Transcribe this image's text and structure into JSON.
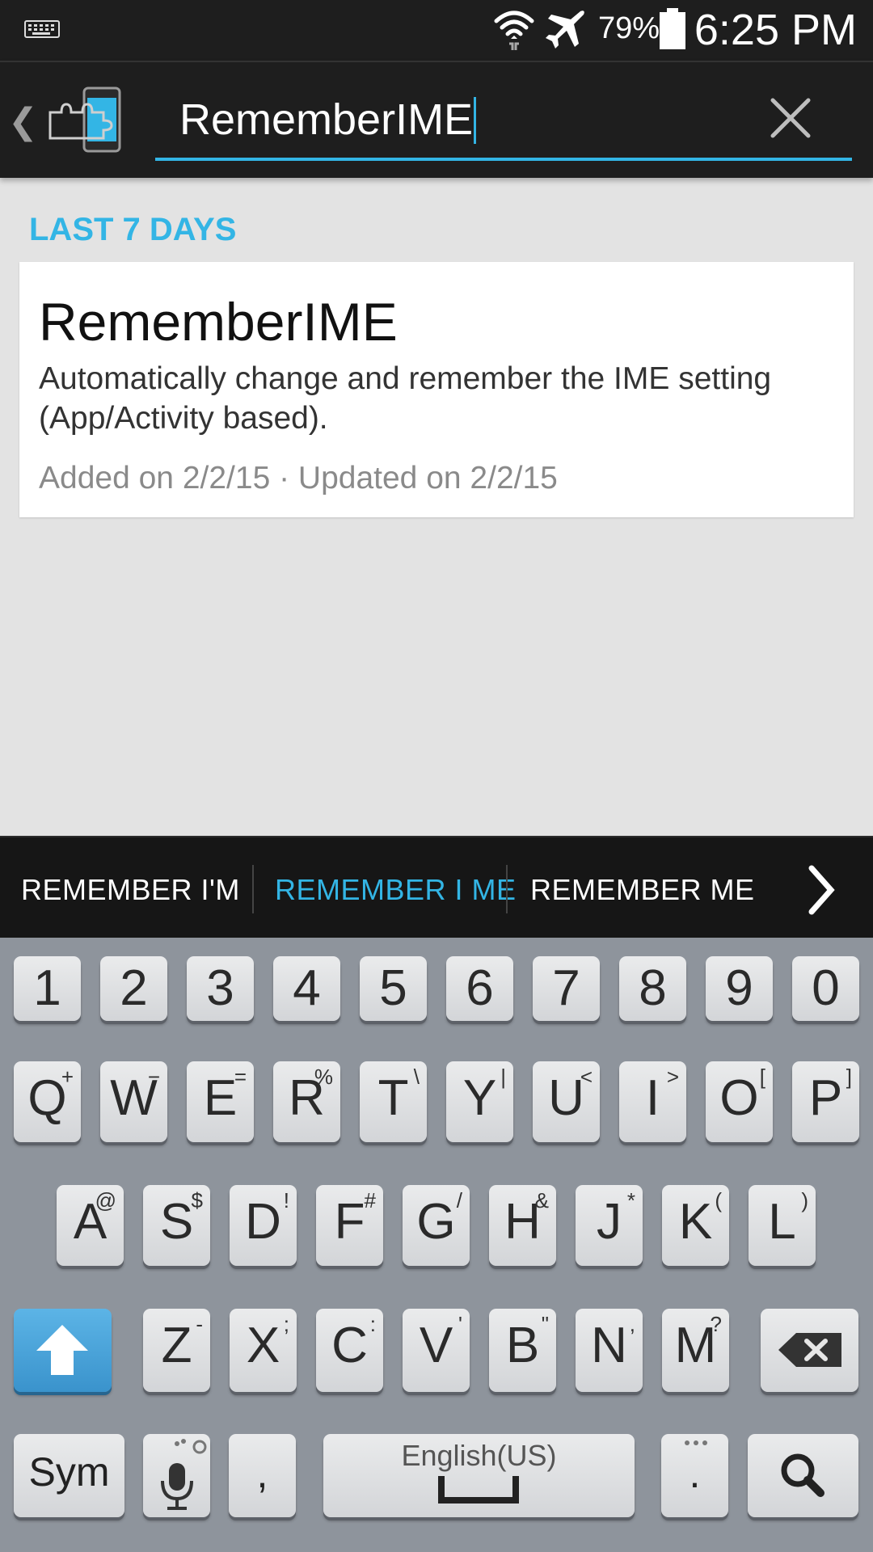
{
  "status_bar": {
    "battery_percent": "79%",
    "time": "6:25 PM",
    "icons": [
      "keyboard-icon",
      "wifi-icon",
      "airplane-mode-icon",
      "battery-icon"
    ]
  },
  "search": {
    "value": "RememberIME",
    "icons": [
      "back-icon",
      "xposed-installer-app-icon",
      "clear-icon"
    ]
  },
  "results": {
    "section_header": "LAST 7 DAYS",
    "items": [
      {
        "title": "RememberIME",
        "description": "Automatically change and remember the IME setting (App/Activity based).",
        "meta": "Added on 2/2/15 · Updated on 2/2/15"
      }
    ]
  },
  "suggestions": {
    "items": [
      "REMEMBER I'M",
      "REMEMBER I ME",
      "REMEMBER ME"
    ],
    "active_index": 1,
    "accent_color": "#33b5e5"
  },
  "keyboard": {
    "number_row": [
      "1",
      "2",
      "3",
      "4",
      "5",
      "6",
      "7",
      "8",
      "9",
      "0"
    ],
    "row1": [
      {
        "key": "Q",
        "sub": "+"
      },
      {
        "key": "W",
        "sub": "−"
      },
      {
        "key": "E",
        "sub": "="
      },
      {
        "key": "R",
        "sub": "%"
      },
      {
        "key": "T",
        "sub": "\\"
      },
      {
        "key": "Y",
        "sub": "|"
      },
      {
        "key": "U",
        "sub": "<"
      },
      {
        "key": "I",
        "sub": ">"
      },
      {
        "key": "O",
        "sub": "["
      },
      {
        "key": "P",
        "sub": "]"
      }
    ],
    "row2": [
      {
        "key": "A",
        "sub": "@"
      },
      {
        "key": "S",
        "sub": "$"
      },
      {
        "key": "D",
        "sub": "!"
      },
      {
        "key": "F",
        "sub": "#"
      },
      {
        "key": "G",
        "sub": "/"
      },
      {
        "key": "H",
        "sub": "&"
      },
      {
        "key": "J",
        "sub": "*"
      },
      {
        "key": "K",
        "sub": "("
      },
      {
        "key": "L",
        "sub": ")"
      }
    ],
    "row3": [
      {
        "key": "Z",
        "sub": "-"
      },
      {
        "key": "X",
        "sub": ";"
      },
      {
        "key": "C",
        "sub": ":"
      },
      {
        "key": "V",
        "sub": "'"
      },
      {
        "key": "B",
        "sub": "\""
      },
      {
        "key": "N",
        "sub": ","
      },
      {
        "key": "M",
        "sub": "?"
      }
    ],
    "sym_label": "Sym",
    "comma": ",",
    "space_label": "English(US)",
    "period": ".",
    "accent_color": "#3a93cc"
  }
}
